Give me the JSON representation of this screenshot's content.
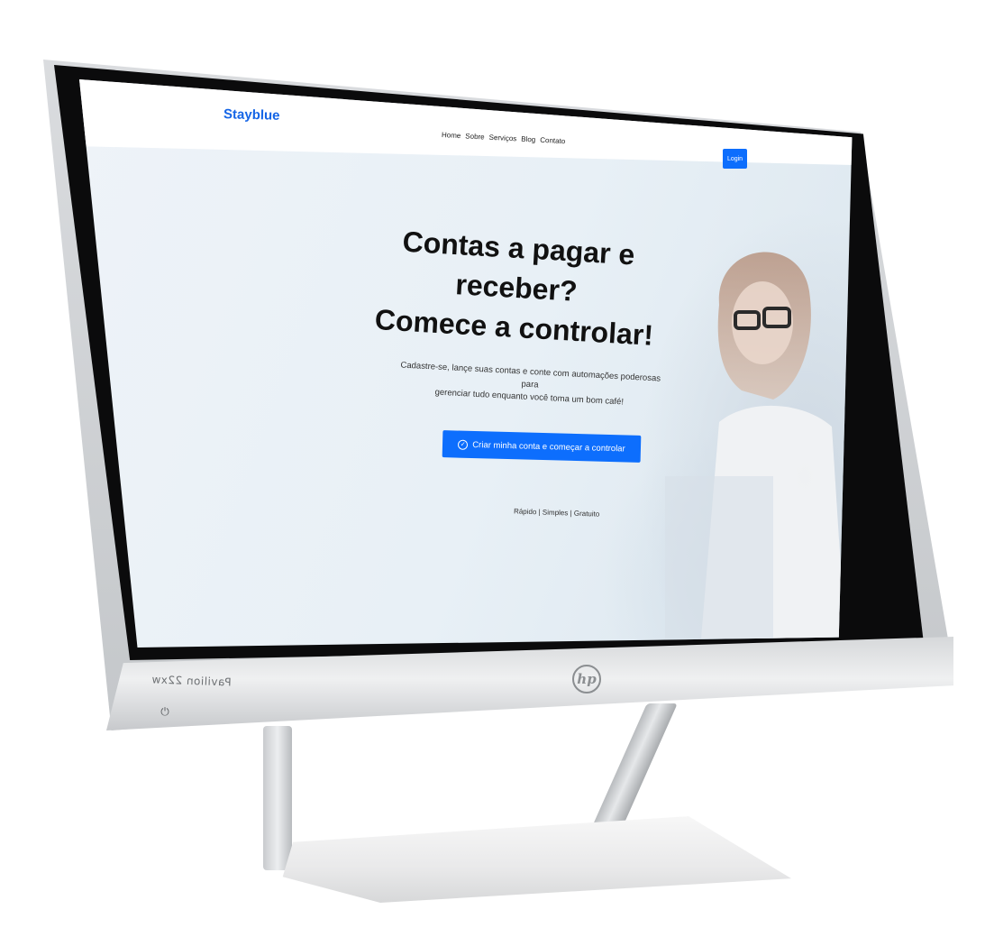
{
  "monitor": {
    "model_label": "Pavilion 22xw",
    "power_icon": "power-icon",
    "logo": "hp-logo"
  },
  "site": {
    "brand": "Stayblue",
    "nav": [
      "Home",
      "Sobre",
      "Serviços",
      "Blog",
      "Contato"
    ],
    "login_label": "Login",
    "hero": {
      "title_line1": "Contas a pagar e receber?",
      "title_line2": "Comece a controlar!",
      "subtitle_line1": "Cadastre-se, lançe suas contas e conte com automações poderosas para",
      "subtitle_line2": "gerenciar tudo enquanto você toma um bom café!",
      "cta_label": "Criar minha conta e começar a controlar",
      "cta_icon": "check-circle-icon",
      "tagline": "Rápido | Simples | Gratuito"
    },
    "colors": {
      "brand": "#1565e6",
      "primary_button": "#0d6efd"
    }
  }
}
